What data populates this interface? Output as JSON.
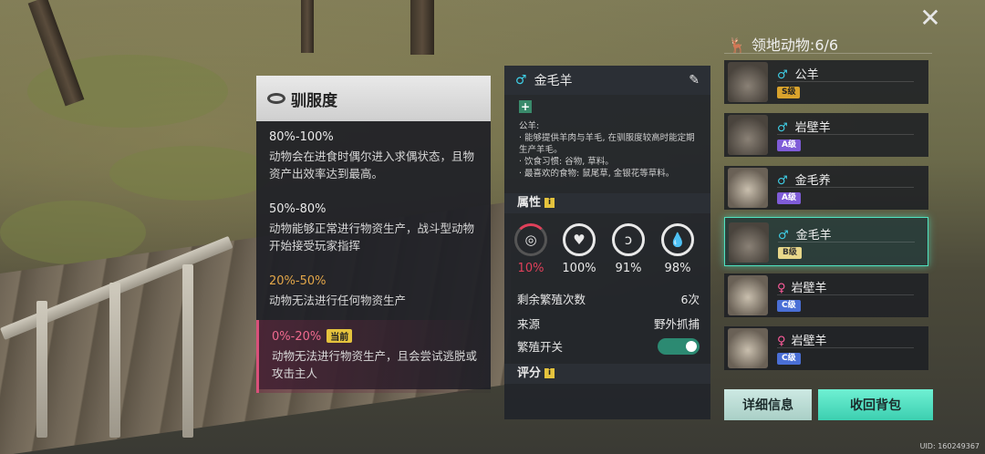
{
  "tame_panel": {
    "title": "驯服度",
    "levels": [
      {
        "range": "80%-100%",
        "desc": "动物会在进食时偶尔进入求偶状态，且物资产出效率达到最高。"
      },
      {
        "range": "50%-80%",
        "desc": "动物能够正常进行物资生产，战斗型动物开始接受玩家指挥"
      },
      {
        "range": "20%-50%",
        "desc": "动物无法进行任何物资生产"
      },
      {
        "range": "0%-20%",
        "current_tag": "当前",
        "desc": "动物无法进行物资生产，且会尝试逃脱或攻击主人"
      }
    ]
  },
  "detail": {
    "gender_symbol": "♂",
    "name": "金毛羊",
    "edit_icon": "pencil-icon",
    "plus_icon": "+",
    "description": [
      "公羊:",
      "· 能够提供羊肉与羊毛, 在驯服度较高时能定期生产羊毛。",
      "· 饮食习惯: 谷物, 草料。",
      "· 最喜欢的食物: 鼠尾草, 金银花等草料。"
    ],
    "attributes_title": "属性",
    "info_mark": "i",
    "stats": [
      {
        "icon": "collar-icon",
        "value": "10%"
      },
      {
        "icon": "heart-icon",
        "value": "100%"
      },
      {
        "icon": "stomach-icon",
        "value": "91%"
      },
      {
        "icon": "water-drop-icon",
        "value": "98%"
      }
    ],
    "rows": [
      {
        "label": "剩余繁殖次数",
        "value": "6次"
      },
      {
        "label": "来源",
        "value": "野外抓捕"
      }
    ],
    "breed_toggle_label": "繁殖开关",
    "breed_toggle_on": true,
    "rating_title": "评分"
  },
  "roster": {
    "title": "领地动物:6/6",
    "close_icon": "close-icon",
    "animals": [
      {
        "gender": "♂",
        "name": "公羊",
        "grade": "S级",
        "grade_class": "s"
      },
      {
        "gender": "♂",
        "name": "岩壁羊",
        "grade": "A级",
        "grade_class": "a"
      },
      {
        "gender": "♂",
        "name": "金毛养",
        "grade": "A级",
        "grade_class": "a"
      },
      {
        "gender": "♂",
        "name": "金毛羊",
        "grade": "B级",
        "grade_class": "b",
        "selected": true
      },
      {
        "gender": "♀",
        "name": "岩壁羊",
        "grade": "C级",
        "grade_class": "c"
      },
      {
        "gender": "♀",
        "name": "岩壁羊",
        "grade": "C级",
        "grade_class": "c"
      }
    ],
    "details_button": "详细信息",
    "recall_button": "收回背包"
  },
  "uid": "UID: 160249367"
}
